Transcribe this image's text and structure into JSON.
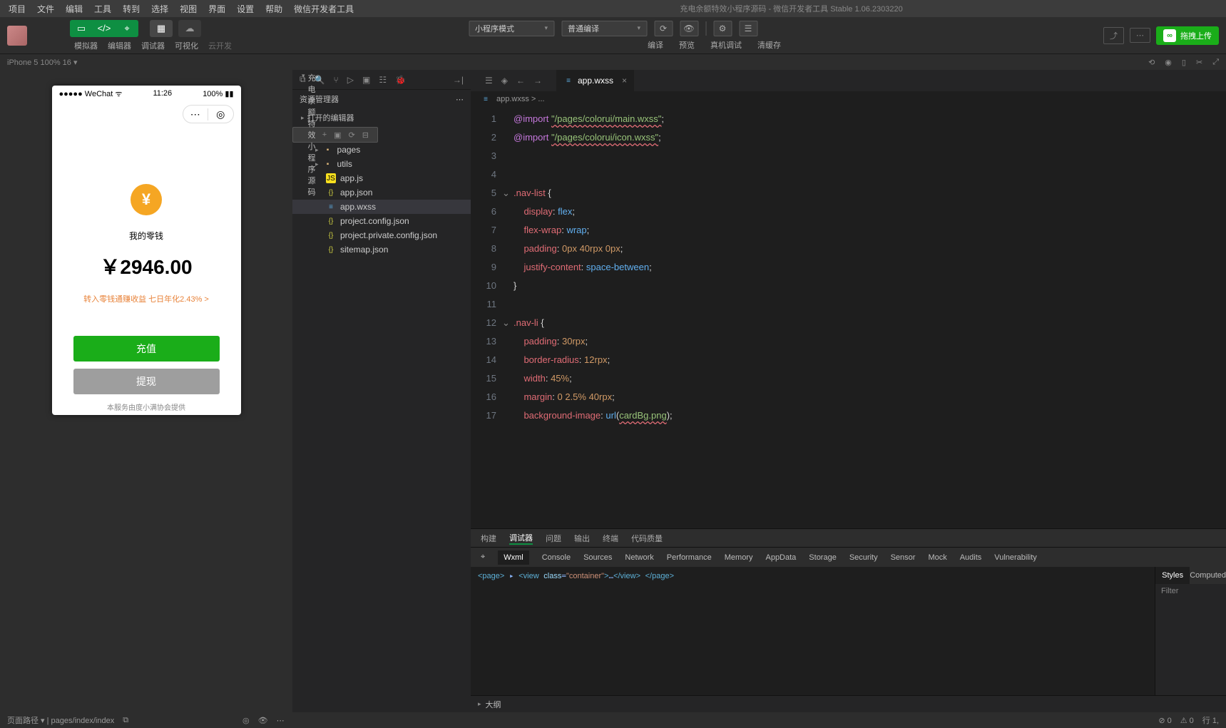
{
  "menubar": [
    "项目",
    "文件",
    "编辑",
    "工具",
    "转到",
    "选择",
    "视图",
    "界面",
    "设置",
    "帮助",
    "微信开发者工具"
  ],
  "title": "充电余额特效小程序源码 - 微信开发者工具 Stable 1.06.2303220",
  "toolbar": {
    "labels": [
      "模拟器",
      "编辑器",
      "调试器",
      "可视化",
      "云开发"
    ],
    "mode_select": "小程序模式",
    "compile_select": "普通编译",
    "center_labels": [
      "编译",
      "预览",
      "真机调试",
      "清缓存"
    ],
    "upload": "拖拽上传"
  },
  "device_bar": {
    "info": "iPhone 5 100% 16 ▾"
  },
  "phone": {
    "carrier": "●●●●● WeChat",
    "wifi": "ᯤ",
    "time": "11:26",
    "batt": "100%",
    "label": "我的零钱",
    "amount": "￥2946.00",
    "link": "转入零钱通赚收益 七日年化2.43% >",
    "btn1": "充值",
    "btn2": "提现",
    "foot": "本服务由度小满协会提供"
  },
  "explorer": {
    "title": "资源管理器",
    "section1": "打开的编辑器",
    "section2": "充电余额特效小程序源码",
    "tree": [
      {
        "depth": 1,
        "icon": "folder",
        "name": "pages",
        "exp": "▸"
      },
      {
        "depth": 1,
        "icon": "folder",
        "name": "utils",
        "exp": "▸"
      },
      {
        "depth": 1,
        "icon": "js",
        "name": "app.js"
      },
      {
        "depth": 1,
        "icon": "json",
        "name": "app.json"
      },
      {
        "depth": 1,
        "icon": "wxss",
        "name": "app.wxss",
        "active": true
      },
      {
        "depth": 1,
        "icon": "json",
        "name": "project.config.json"
      },
      {
        "depth": 1,
        "icon": "json",
        "name": "project.private.config.json"
      },
      {
        "depth": 1,
        "icon": "json",
        "name": "sitemap.json"
      }
    ]
  },
  "editor": {
    "tab": "app.wxss",
    "crumb": "app.wxss > ...",
    "gutter": [
      "1",
      "2",
      "3",
      "4",
      "5",
      "6",
      "7",
      "8",
      "9",
      "10",
      "11",
      "12",
      "13",
      "14",
      "15",
      "16",
      "17"
    ]
  },
  "debugger": {
    "top": [
      "构建",
      "调试器",
      "问题",
      "输出",
      "终端",
      "代码质量"
    ],
    "dev": [
      "Wxml",
      "Console",
      "Sources",
      "Network",
      "Performance",
      "Memory",
      "AppData",
      "Storage",
      "Security",
      "Sensor",
      "Mock",
      "Audits",
      "Vulnerability"
    ],
    "styles_tabs": [
      "Styles",
      "Computed"
    ],
    "filter": "Filter"
  },
  "outline": "大纲",
  "statusbar": {
    "path": "页面路径 ▾ | pages/index/index",
    "right": "行 1,"
  }
}
